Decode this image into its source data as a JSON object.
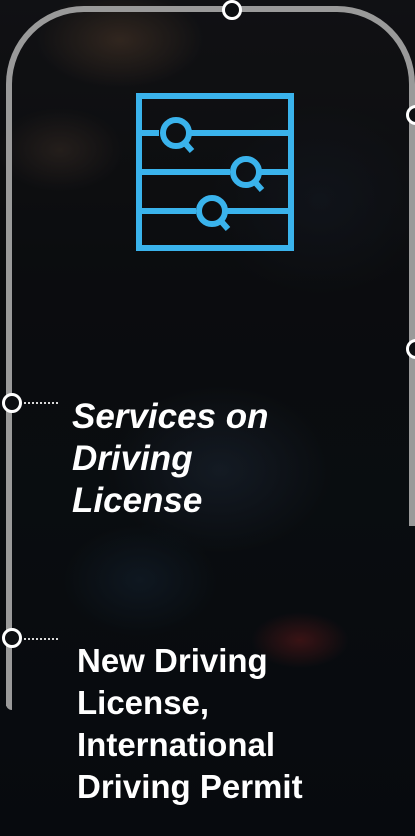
{
  "icon": {
    "name": "sliders-settings-icon",
    "color": "#3ab3ec"
  },
  "frame": {
    "line_color": "#9a9a9a",
    "node_color": "#ffffff"
  },
  "section_1": {
    "lines": [
      "Services on",
      "Driving",
      "License"
    ]
  },
  "section_2": {
    "lines": [
      "New Driving",
      "License,",
      "International",
      "Driving Permit"
    ]
  }
}
